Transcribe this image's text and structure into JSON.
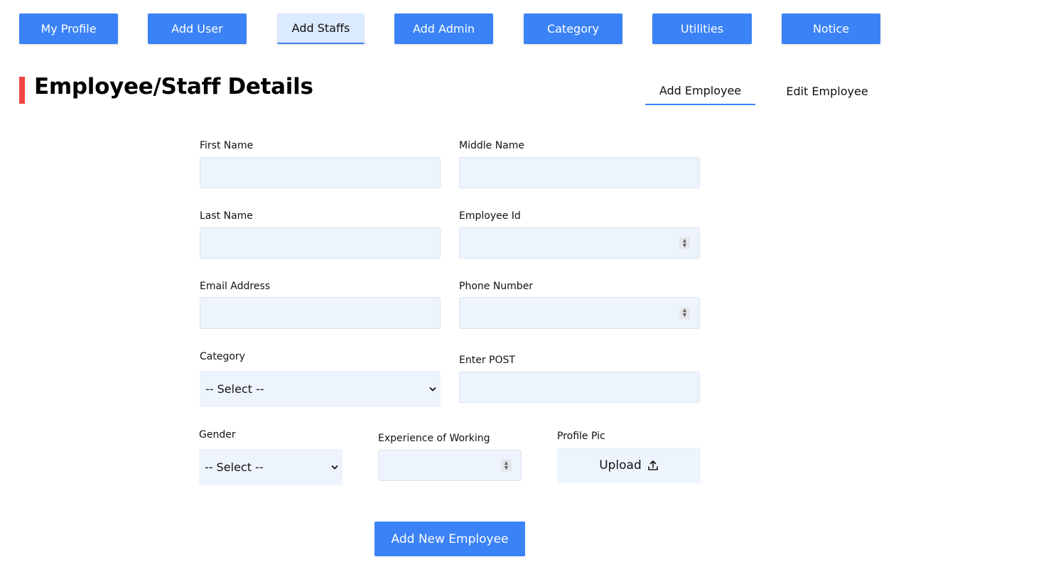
{
  "nav": {
    "my_profile": "My Profile",
    "add_user": "Add User",
    "add_staffs": "Add Staffs",
    "add_admin": "Add Admin",
    "category": "Category",
    "utilities": "Utilities",
    "notice": "Notice",
    "active": "Add Staffs"
  },
  "page": {
    "title": "Employee/Staff Details",
    "accent_color": "#ef4444"
  },
  "tabs": {
    "add_employee": "Add Employee",
    "edit_employee": "Edit Employee",
    "active": "Add Employee"
  },
  "form": {
    "first_name": {
      "label": "First Name",
      "value": ""
    },
    "middle_name": {
      "label": "Middle Name",
      "value": ""
    },
    "last_name": {
      "label": "Last Name",
      "value": ""
    },
    "employee_id": {
      "label": "Employee Id",
      "value": ""
    },
    "email": {
      "label": "Email Address",
      "value": ""
    },
    "phone": {
      "label": "Phone Number",
      "value": ""
    },
    "category": {
      "label": "Category",
      "selected": "-- Select --"
    },
    "post": {
      "label": "Enter POST",
      "value": ""
    },
    "gender": {
      "label": "Gender",
      "selected": "-- Select --"
    },
    "experience": {
      "label": "Experience of Working",
      "value": ""
    },
    "profile_pic": {
      "label": "Profile Pic",
      "button": "Upload"
    },
    "submit": "Add New Employee"
  },
  "colors": {
    "primary": "#3b82f6",
    "input_bg": "#eef4fd",
    "active_nav_bg": "#dbeafe"
  }
}
